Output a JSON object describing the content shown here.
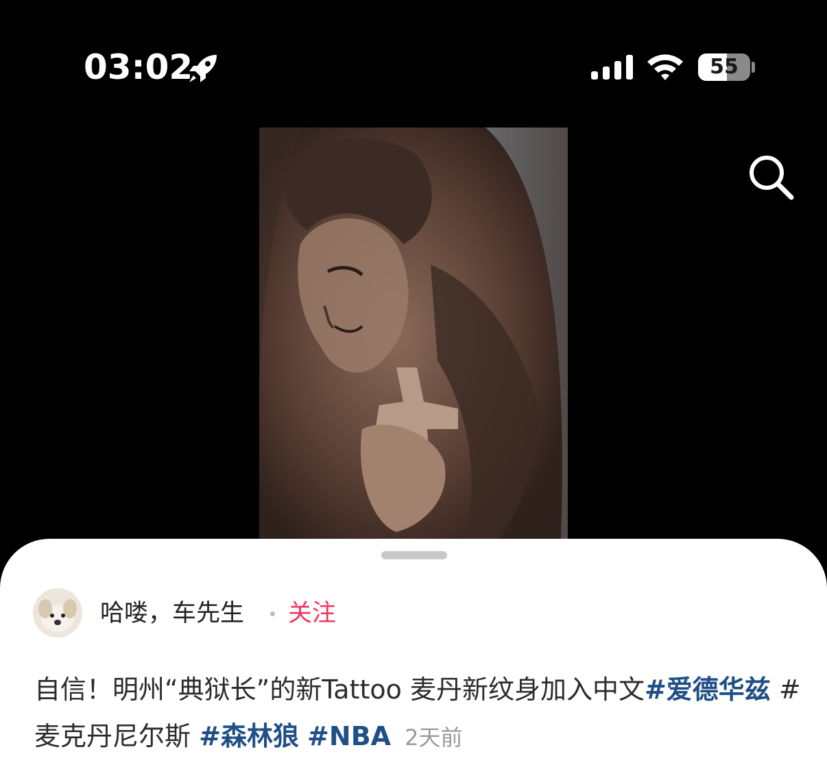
{
  "status_bar": {
    "time": "03:02",
    "battery_level": "55",
    "battery_fraction": 0.55,
    "icons": [
      "rocket-icon",
      "cellular-signal-icon",
      "wifi-icon",
      "battery-icon"
    ]
  },
  "header": {
    "search_icon": "search-icon"
  },
  "media": {
    "description_icon": "tattoo-photo"
  },
  "post": {
    "author_name": "哈喽，车先生",
    "follow_label": "关注",
    "caption_text": "自信！明州“典狱长”的新Tattoo 麦丹新纹身加入中文",
    "hashtags": [
      {
        "text": "#爱德华兹"
      },
      {
        "text": "#麦克丹尼尔斯"
      },
      {
        "text": "#森林狼"
      },
      {
        "text": "#NBA"
      }
    ],
    "time_ago": "2天前"
  },
  "colors": {
    "background": "#000000",
    "sheet": "#ffffff",
    "follow_accent": "#f2355f",
    "hashtag": "#1f4f86",
    "muted": "#9a9a9a"
  }
}
